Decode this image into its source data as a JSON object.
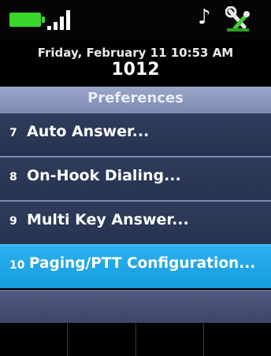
{
  "status": {
    "battery_color": "#39d82b",
    "battery_icon": "battery-icon",
    "signal_icon": "signal-bars-icon",
    "note_icon": "music-note-icon",
    "tool_icon": "tools-icon",
    "note_glyph": "♪"
  },
  "header": {
    "date_time": "Friday, February 11 10:53 AM",
    "extension": "1012"
  },
  "title": "Preferences",
  "menu": [
    {
      "num": "7",
      "label": "Auto Answer..."
    },
    {
      "num": "8",
      "label": "On-Hook Dialing..."
    },
    {
      "num": "9",
      "label": "Multi Key Answer..."
    },
    {
      "num": "10",
      "label": "Paging/PTT Configuration...",
      "selected": true
    }
  ],
  "softkeys": [
    "",
    "",
    "",
    ""
  ],
  "colors": {
    "selected": "#1fa6e6",
    "item": "#2b3756",
    "title": "#8894bd"
  }
}
